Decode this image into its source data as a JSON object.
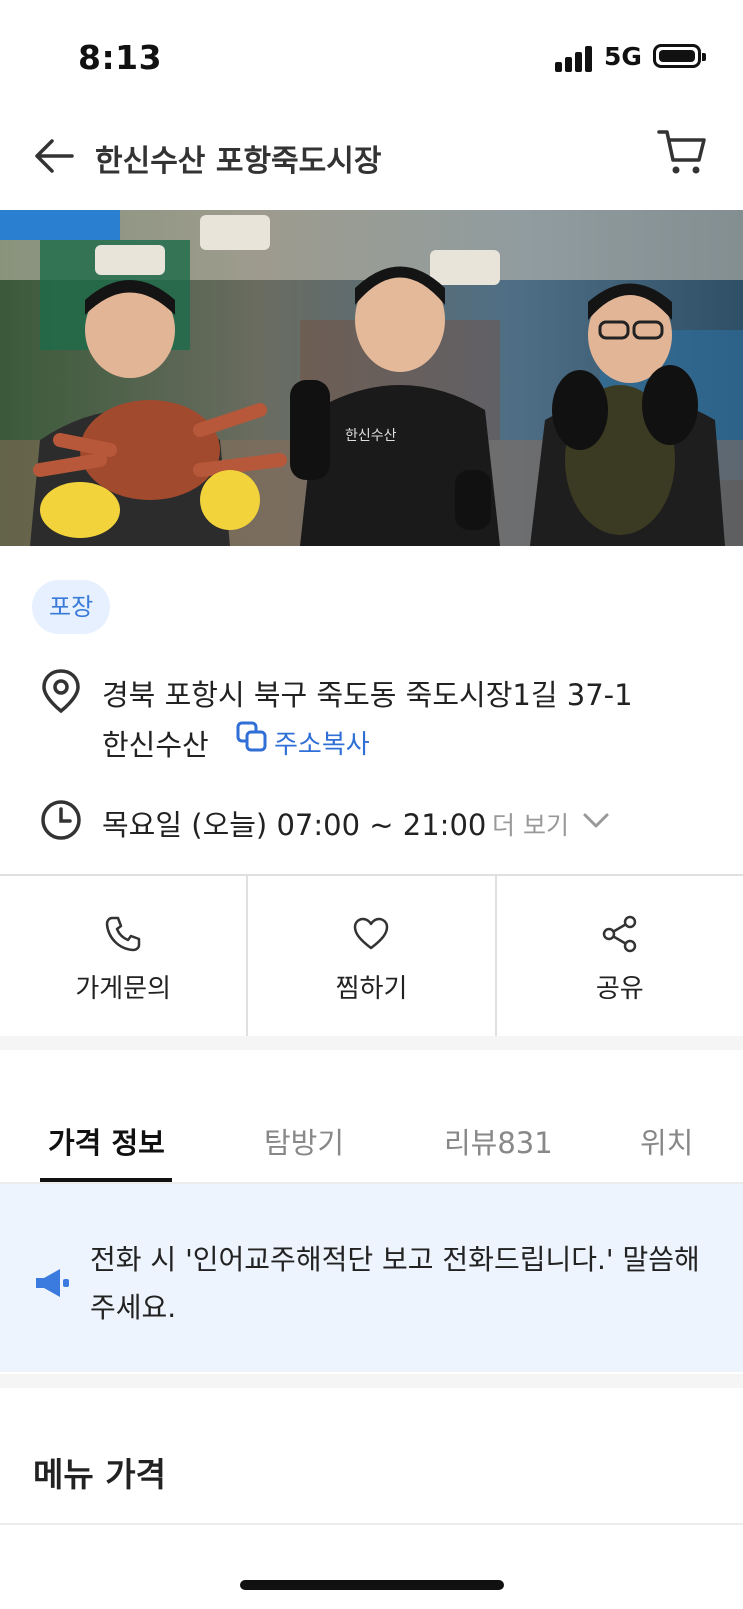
{
  "status_bar": {
    "time": "8:13",
    "network": "5G"
  },
  "header": {
    "title": "한신수산 포항죽도시장"
  },
  "hero": {
    "shirt_text": "한신수산"
  },
  "store": {
    "tag": "포장",
    "address_line1": "경북 포항시 북구 죽도동 죽도시장1길 37-1",
    "address_line2": "한신수산",
    "copy_address_label": "주소복사",
    "hours": "목요일 (오늘) 07:00 ~ 21:00",
    "more_label": "더 보기"
  },
  "actions": [
    {
      "label": "가게문의",
      "icon": "phone-icon"
    },
    {
      "label": "찜하기",
      "icon": "heart-icon"
    },
    {
      "label": "공유",
      "icon": "share-icon"
    }
  ],
  "tabs": [
    {
      "label": "가격 정보",
      "active": true
    },
    {
      "label": "탐방기",
      "active": false
    },
    {
      "label": "리뷰831",
      "active": false
    },
    {
      "label": "위치",
      "active": false
    }
  ],
  "notice": {
    "text": "전화 시 '인어교주해적단 보고 전화드립니다.' 말씀해 주세요."
  },
  "menu_section": {
    "title": "메뉴 가격"
  },
  "colors": {
    "accent": "#2f6fd6",
    "tag_bg": "#e6f0ff",
    "notice_bg": "#eef4fd"
  }
}
